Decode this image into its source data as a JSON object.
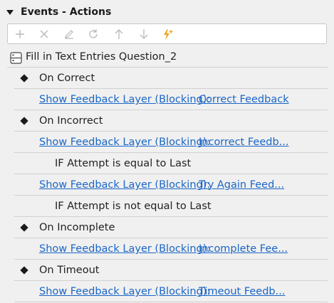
{
  "panel": {
    "title": "Events - Actions"
  },
  "toolbar": {
    "icons": [
      "plus-icon",
      "close-icon",
      "pencil-icon",
      "refresh-icon",
      "arrow-up-icon",
      "arrow-down-icon",
      "lightning-add-icon"
    ],
    "accent_color": "#e8a317"
  },
  "trigger": {
    "label": "Fill in Text Entries Question_2"
  },
  "events": {
    "on_correct": "On Correct",
    "on_incorrect": "On Incorrect",
    "on_incomplete": "On Incomplete",
    "on_timeout": "On Timeout"
  },
  "actions": {
    "correct": {
      "action": "Show Feedback Layer (Blocking):",
      "target": "Correct Feedback"
    },
    "incorrect": {
      "action": "Show Feedback Layer (Blocking):",
      "target": "Incorrect Feedb..."
    },
    "condition_last": "IF Attempt is equal to Last",
    "try_again": {
      "action": "Show Feedback Layer (Blocking):",
      "target": "Try Again Feed..."
    },
    "condition_not_last": "IF Attempt is not equal to Last",
    "incomplete": {
      "action": "Show Feedback Layer (Blocking):",
      "target": "Incomplete Fee..."
    },
    "timeout": {
      "action": "Show Feedback Layer (Blocking):",
      "target": "Timeout Feedb..."
    }
  },
  "colors": {
    "link": "#1a66c6",
    "background": "#f0f0f0"
  }
}
